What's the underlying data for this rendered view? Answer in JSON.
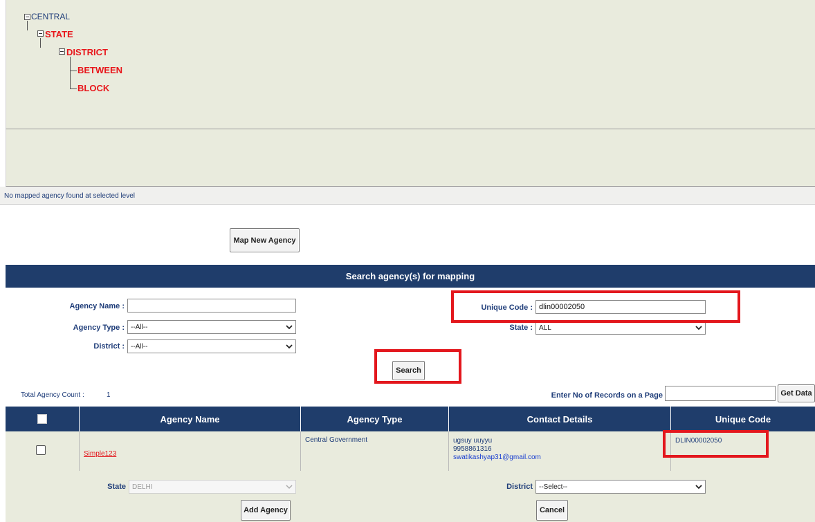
{
  "tree": {
    "root": "CENTRAL",
    "state": "STATE",
    "district": "DISTRICT",
    "between": "BETWEEN",
    "block": "BLOCK"
  },
  "status_message": "No mapped agency found at selected level",
  "map_new_agency_label": "Map New Agency",
  "search": {
    "header": "Search agency(s) for mapping",
    "agency_name_label": "Agency Name :",
    "agency_name_value": "",
    "agency_type_label": "Agency Type :",
    "agency_type_value": "--All--",
    "district_label": "District :",
    "district_value": "--All--",
    "unique_code_label": "Unique Code :",
    "unique_code_value": "dlin00002050",
    "state_label": "State :",
    "state_value": "ALL",
    "search_button": "Search"
  },
  "results": {
    "total_label": "Total Agency Count :",
    "total_count": "1",
    "records_label": "Enter No of Records on a Page",
    "records_value": "",
    "get_data_button": "Get Data",
    "columns": [
      "Agency Name",
      "Agency Type",
      "Contact Details",
      "Unique Code"
    ],
    "rows": [
      {
        "agency_name": "Simple123",
        "agency_type": "Central Government",
        "contact_name": "ugsuy uuyyu",
        "contact_phone": "9958861316",
        "contact_email": "swatikashyap31@gmail.com",
        "unique_code": "DLIN00002050"
      }
    ]
  },
  "bottom": {
    "state_label": "State",
    "state_value": "DELHI",
    "district_label": "District",
    "district_value": "--Select--",
    "add_agency_button": "Add Agency",
    "cancel_button": "Cancel"
  },
  "colors": {
    "panel_bg": "#e9ebdd",
    "header_bg": "#1f3d6b",
    "highlight": "#e3171d",
    "tree_red": "#e8161b",
    "link": "#1a3fd0"
  }
}
